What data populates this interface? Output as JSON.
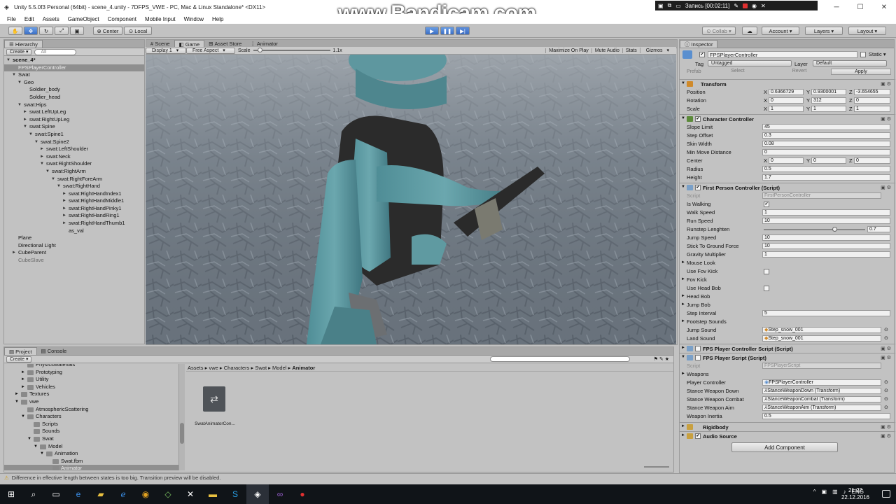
{
  "window": {
    "title": "Unity 5.5.0f3 Personal (64bit) - scene_4.unity - 7DFPS_VWE - PC, Mac & Linux Standalone* <DX11>",
    "watermark": "www.Bandicam.com",
    "recording": "Запись [00:02:11]"
  },
  "menu": [
    "File",
    "Edit",
    "Assets",
    "GameObject",
    "Component",
    "Mobile Input",
    "Window",
    "Help"
  ],
  "toolbar": {
    "pivot": "Center",
    "space": "Local",
    "collab": "Collab",
    "account": "Account",
    "layers": "Layers",
    "layout": "Layout"
  },
  "hierarchy": {
    "tab": "Hierarchy",
    "create": "Create",
    "search_placeholder": "All",
    "rows": [
      {
        "label": "scene_4*",
        "indent": 0,
        "arrow": "▼",
        "bold": true
      },
      {
        "label": "FPSPlayerController",
        "indent": 1,
        "selected": true
      },
      {
        "label": "Swat",
        "indent": 1,
        "arrow": "▼"
      },
      {
        "label": "Geo",
        "indent": 2,
        "arrow": "▼"
      },
      {
        "label": "Soldier_body",
        "indent": 3
      },
      {
        "label": "Soldier_head",
        "indent": 3
      },
      {
        "label": "swat:Hips",
        "indent": 2,
        "arrow": "▼"
      },
      {
        "label": "swat:LeftUpLeg",
        "indent": 3,
        "arrow": "►"
      },
      {
        "label": "swat:RightUpLeg",
        "indent": 3,
        "arrow": "►"
      },
      {
        "label": "swat:Spine",
        "indent": 3,
        "arrow": "▼"
      },
      {
        "label": "swat:Spine1",
        "indent": 4,
        "arrow": "▼"
      },
      {
        "label": "swat:Spine2",
        "indent": 5,
        "arrow": "▼"
      },
      {
        "label": "swat:LeftShoulder",
        "indent": 6,
        "arrow": "►"
      },
      {
        "label": "swat:Neck",
        "indent": 6,
        "arrow": "►"
      },
      {
        "label": "swat:RightShoulder",
        "indent": 6,
        "arrow": "▼"
      },
      {
        "label": "swat:RightArm",
        "indent": 7,
        "arrow": "▼"
      },
      {
        "label": "swat:RightForeArm",
        "indent": 8,
        "arrow": "▼"
      },
      {
        "label": "swat:RightHand",
        "indent": 9,
        "arrow": "▼"
      },
      {
        "label": "swat:RightHandIndex1",
        "indent": 10,
        "arrow": "►"
      },
      {
        "label": "swat:RightHandMiddle1",
        "indent": 10,
        "arrow": "►"
      },
      {
        "label": "swat:RightHandPinky1",
        "indent": 10,
        "arrow": "►"
      },
      {
        "label": "swat:RightHandRing1",
        "indent": 10,
        "arrow": "►"
      },
      {
        "label": "swat:RightHandThumb1",
        "indent": 10,
        "arrow": "►"
      },
      {
        "label": "as_val",
        "indent": 10
      },
      {
        "label": "Plane",
        "indent": 1
      },
      {
        "label": "Directional Light",
        "indent": 1
      },
      {
        "label": "CubeParent",
        "indent": 1,
        "arrow": "►"
      },
      {
        "label": "CubeSlave",
        "indent": 1,
        "gray": true
      }
    ]
  },
  "gameview": {
    "tabs": [
      "Scene",
      "Game",
      "Asset Store",
      "Animator"
    ],
    "active_tab": "Game",
    "display": "Display 1",
    "aspect": "Free Aspect",
    "scale_label": "Scale",
    "scale_value": "1.1x",
    "options": [
      "Maximize On Play",
      "Mute Audio",
      "Stats",
      "Gizmos"
    ]
  },
  "inspector": {
    "tab": "Inspector",
    "object_name": "FPSPlayerController",
    "static_label": "Static",
    "tag_label": "Tag",
    "tag_value": "Untagged",
    "layer_label": "Layer",
    "layer_value": "Default",
    "prefab_label": "Prefab",
    "prefab_buttons": [
      "Select",
      "Revert",
      "Apply"
    ],
    "transform": {
      "title": "Transform",
      "position": {
        "label": "Position",
        "x": "0.6366729",
        "y": "0.9300001",
        "z": "-3.654655"
      },
      "rotation": {
        "label": "Rotation",
        "x": "0",
        "y": "312",
        "z": "0"
      },
      "scale": {
        "label": "Scale",
        "x": "1",
        "y": "1",
        "z": "1"
      }
    },
    "character_controller": {
      "title": "Character Controller",
      "fields": [
        {
          "label": "Slope Limit",
          "value": "45"
        },
        {
          "label": "Step Offset",
          "value": "0.3"
        },
        {
          "label": "Skin Width",
          "value": "0.08"
        },
        {
          "label": "Min Move Distance",
          "value": "0"
        }
      ],
      "center": {
        "label": "Center",
        "x": "0",
        "y": "0",
        "z": "0"
      },
      "radius": {
        "label": "Radius",
        "value": "0.5"
      },
      "height": {
        "label": "Height",
        "value": "1.7"
      }
    },
    "fpc": {
      "title": "First Person Controller (Script)",
      "script_label": "Script",
      "script_value": "FirstPersonController",
      "is_walking": "Is Walking",
      "walk_speed": {
        "label": "Walk Speed",
        "value": "1"
      },
      "run_speed": {
        "label": "Run Speed",
        "value": "10"
      },
      "runstep": {
        "label": "Runstep Lenghten",
        "value": "0.7",
        "fraction": 0.7
      },
      "jump_speed": {
        "label": "Jump Speed",
        "value": "10"
      },
      "stick": {
        "label": "Stick To Ground Force",
        "value": "10"
      },
      "gravity": {
        "label": "Gravity Multiplier",
        "value": "1"
      },
      "mouse_look": "Mouse Look",
      "use_fov_kick": "Use Fov Kick",
      "fov_kick": "Fov Kick",
      "use_head_bob": "Use Head Bob",
      "head_bob": "Head Bob",
      "jump_bob": "Jump Bob",
      "step_interval": {
        "label": "Step Interval",
        "value": "5"
      },
      "footstep": "Footstep Sounds",
      "jump_sound": {
        "label": "Jump Sound",
        "value": "Step_snow_001"
      },
      "land_sound": {
        "label": "Land Sound",
        "value": "Step_snow_001"
      }
    },
    "fps_pcs": {
      "title": "FPS Player Controller Script (Script)"
    },
    "fps_ps": {
      "title": "FPS Player Script (Script)",
      "script_label": "Script",
      "script_value": "FPSPlayerScript",
      "weapons": "Weapons",
      "player_controller": {
        "label": "Player Controller",
        "value": "FPSPlayerController"
      },
      "stance_down": {
        "label": "Stance Weapon Down",
        "value": "StanceWeaponDown (Transform)"
      },
      "stance_combat": {
        "label": "Stance Weapon Combat",
        "value": "StanceWeaponCombat (Transform)"
      },
      "stance_aim": {
        "label": "Stance Weapon Aim",
        "value": "StanceWeaponAim (Transform)"
      },
      "inertia": {
        "label": "Weapon Inertia",
        "value": "0.5"
      }
    },
    "rigidbody": {
      "title": "Rigidbody"
    },
    "audio": {
      "title": "Audio Source"
    },
    "add_component": "Add Component"
  },
  "project": {
    "tabs": [
      "Project",
      "Console"
    ],
    "create": "Create",
    "tree": [
      {
        "label": "PhysicsMaterials",
        "indent": 2
      },
      {
        "label": "Prototyping",
        "indent": 2,
        "arrow": "►"
      },
      {
        "label": "Utility",
        "indent": 2,
        "arrow": "►"
      },
      {
        "label": "Vehicles",
        "indent": 2,
        "arrow": "►"
      },
      {
        "label": "Textures",
        "indent": 1,
        "arrow": "►"
      },
      {
        "label": "vwe",
        "indent": 1,
        "arrow": "▼"
      },
      {
        "label": "AtmosphericScattering",
        "indent": 2
      },
      {
        "label": "Characters",
        "indent": 2,
        "arrow": "▼"
      },
      {
        "label": "Scripts",
        "indent": 3
      },
      {
        "label": "Sounds",
        "indent": 3
      },
      {
        "label": "Swat",
        "indent": 3,
        "arrow": "▼"
      },
      {
        "label": "Model",
        "indent": 4,
        "arrow": "▼"
      },
      {
        "label": "Animation",
        "indent": 5,
        "arrow": "▼"
      },
      {
        "label": "Swat.fbm",
        "indent": 6
      },
      {
        "label": "Animator",
        "indent": 6,
        "selected": true
      }
    ],
    "breadcrumb": [
      "Assets",
      "vwe",
      "Characters",
      "Swat",
      "Model",
      "Animator"
    ],
    "asset_name": "SwatAnimatorCon..."
  },
  "status": "Difference in effective length between states is too big. Transition preview will be disabled.",
  "taskbar": {
    "lang": "ENG",
    "time": "21:22",
    "date": "22.12.2016"
  }
}
